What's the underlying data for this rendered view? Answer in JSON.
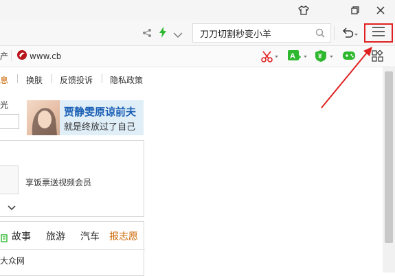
{
  "titlebar": {
    "icons": [
      "shirt-icon",
      "restore-icon",
      "close-icon"
    ]
  },
  "addressbar": {
    "search_text": "刀刀切割秒变小羊",
    "icons": [
      "share-icon",
      "lightning-icon",
      "chevron-down-icon",
      "search-icon",
      "undo-icon",
      "menu-icon"
    ]
  },
  "bookmarks": {
    "left_fragment": "产",
    "site_label": "www.cb",
    "icons": [
      "scissors-icon",
      "translate-icon",
      "yen-icon",
      "gamepad-icon",
      "grid-icon"
    ]
  },
  "content": {
    "nav": {
      "item0": "息",
      "item1": "换肤",
      "item2": "反馈投诉",
      "item3": "隐私政策"
    },
    "left_char": "光",
    "ad": {
      "line1": "贾静雯原谅前夫",
      "line2": "就是终放过了自己"
    },
    "promo": "享饭票送视频会员",
    "tabs": {
      "t1": "故事",
      "t2": "旅游",
      "t3": "汽车",
      "t4": "报志愿"
    },
    "bottom": "大众网"
  },
  "colors": {
    "annotation": "#e02020",
    "ad_title": "#1b5fb5",
    "highlight": "#cc6600",
    "green_icon": "#2eb82e"
  }
}
